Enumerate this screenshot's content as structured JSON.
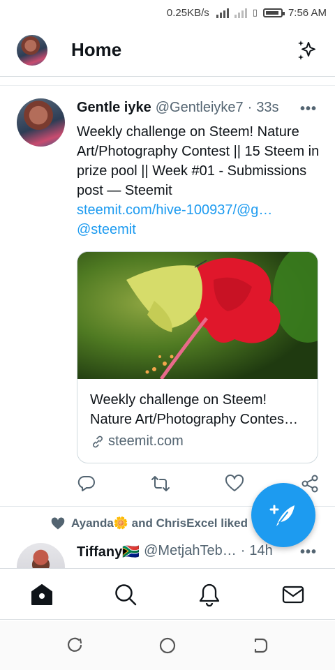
{
  "status_bar": {
    "net_speed": "0.25KB/s",
    "time": "7:56 AM"
  },
  "header": {
    "title": "Home"
  },
  "tweet": {
    "name": "Gentle iyke",
    "handle": "@Gentleiyke7",
    "separator": "·",
    "time": "33s",
    "text": "Weekly challenge on Steem! Nature Art/Photography Contest || 15 Steem in prize pool || Week #01 - Submissions post — Steemit",
    "link": "steemit.com/hive-100937/@g…",
    "mention": "@steemit",
    "card": {
      "title_line1": "Weekly challenge on Steem!",
      "title_line2": "Nature Art/Photography Contes…",
      "domain": "steemit.com"
    }
  },
  "second_tweet": {
    "liked_by": "Ayanda🌼 and ChrisExcel liked",
    "name": "Tiffany🇿🇦",
    "handle": "@MetjahTeb…",
    "separator": "·",
    "time": "14h"
  },
  "icons": {
    "accent": "#1d9bf0",
    "header": "sparkle-icon",
    "actions": [
      "reply-icon",
      "retweet-icon",
      "like-icon",
      "share-icon"
    ],
    "fab": "compose-icon",
    "bottom_nav": [
      "home-icon",
      "search-icon",
      "notifications-icon",
      "messages-icon"
    ],
    "system_nav": [
      "recent-apps-icon",
      "home-circle-icon",
      "back-icon"
    ]
  }
}
